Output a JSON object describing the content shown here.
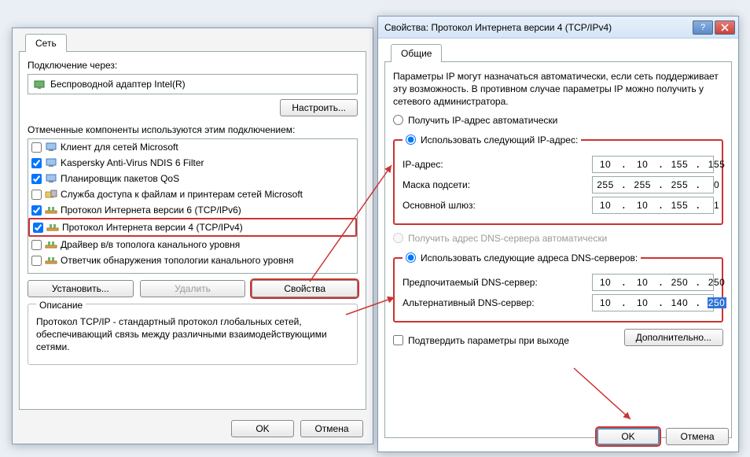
{
  "left": {
    "tab": "Сеть",
    "connectLabel": "Подключение через:",
    "adapter": "Беспроводной адаптер Intel(R)",
    "configureBtn": "Настроить...",
    "componentsLabel": "Отмеченные компоненты используются этим подключением:",
    "items": [
      {
        "checked": false,
        "label": "Клиент для сетей Microsoft",
        "icon": "client"
      },
      {
        "checked": true,
        "label": "Kaspersky Anti-Virus NDIS 6 Filter",
        "icon": "filter"
      },
      {
        "checked": true,
        "label": "Планировщик пакетов QoS",
        "icon": "filter"
      },
      {
        "checked": false,
        "label": "Служба доступа к файлам и принтерам сетей Microsoft",
        "icon": "service"
      },
      {
        "checked": true,
        "label": "Протокол Интернета версии 6 (TCP/IPv6)",
        "icon": "proto"
      },
      {
        "checked": true,
        "label": "Протокол Интернета версии 4 (TCP/IPv4)",
        "icon": "proto",
        "selected": true
      },
      {
        "checked": false,
        "label": "Драйвер в/в тополога канального уровня",
        "icon": "proto"
      },
      {
        "checked": false,
        "label": "Ответчик обнаружения топологии канального уровня",
        "icon": "proto"
      }
    ],
    "installBtn": "Установить...",
    "removeBtn": "Удалить",
    "propsBtn": "Свойства",
    "descLegend": "Описание",
    "descText": "Протокол TCP/IP - стандартный протокол глобальных сетей, обеспечивающий связь между различными взаимодействующими сетями.",
    "ok": "OK",
    "cancel": "Отмена"
  },
  "right": {
    "title": "Свойства: Протокол Интернета версии 4 (TCP/IPv4)",
    "tab": "Общие",
    "intro": "Параметры IP могут назначаться автоматически, если сеть поддерживает эту возможность. В противном случае параметры IP можно получить у сетевого администратора.",
    "ipAutoLabel": "Получить IP-адрес автоматически",
    "ipManualLabel": "Использовать следующий IP-адрес:",
    "ipAddrLabel": "IP-адрес:",
    "ipAddr": [
      "10",
      "10",
      "155",
      "155"
    ],
    "maskLabel": "Маска подсети:",
    "mask": [
      "255",
      "255",
      "255",
      "0"
    ],
    "gwLabel": "Основной шлюз:",
    "gw": [
      "10",
      "10",
      "155",
      "1"
    ],
    "dnsAutoLabel": "Получить адрес DNS-сервера автоматически",
    "dnsManualLabel": "Использовать следующие адреса DNS-серверов:",
    "dnsPrefLabel": "Предпочитаемый DNS-сервер:",
    "dnsPref": [
      "10",
      "10",
      "250",
      "250"
    ],
    "dnsAltLabel": "Альтернативный DNS-сервер:",
    "dnsAlt": [
      "10",
      "10",
      "140",
      "250"
    ],
    "validateLabel": "Подтвердить параметры при выходе",
    "advancedBtn": "Дополнительно...",
    "ok": "OK",
    "cancel": "Отмена"
  }
}
